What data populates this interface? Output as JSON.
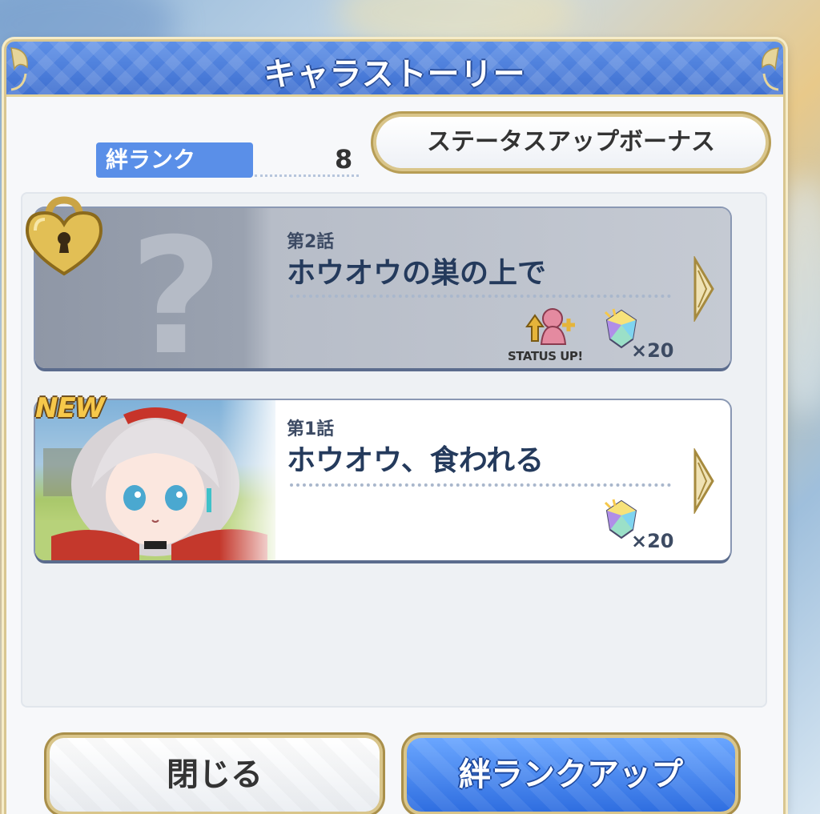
{
  "dialog": {
    "title": "キャラストーリー",
    "bond_rank_label": "絆ランク",
    "bond_rank_value": "8",
    "status_bonus_button": "ステータスアップボーナス"
  },
  "stories": [
    {
      "episode": "第2話",
      "title": "ホウオウの巣の上で",
      "locked": true,
      "status_up_text": "STATUS UP!",
      "reward_count": "×20"
    },
    {
      "episode": "第1話",
      "title": "ホウオウ、食われる",
      "locked": false,
      "badge": "NEW",
      "reward_count": "×20"
    }
  ],
  "buttons": {
    "close": "閉じる",
    "bond_rank_up": "絆ランクアップ"
  },
  "icons": {
    "lock": "heart-lock-icon",
    "gem": "jewel-icon",
    "status_up": "status-up-icon",
    "chevron": "chevron-right-icon"
  },
  "colors": {
    "title_bar": "#4a7ddc",
    "bond_label": "#5a8fe8",
    "gold_border": "#d9c58a",
    "rank_up_button": "#3f7be6"
  }
}
